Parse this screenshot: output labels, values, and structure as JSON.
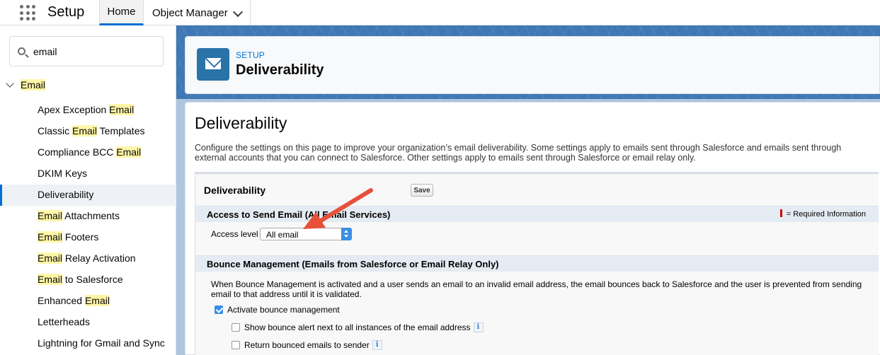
{
  "nav": {
    "app_title": "Setup",
    "tabs": [
      {
        "label": "Home",
        "active": true
      },
      {
        "label": "Object Manager",
        "active": false
      }
    ]
  },
  "sidebar": {
    "search": {
      "value": "email"
    },
    "parent": {
      "label": "Email",
      "expanded": true
    },
    "items": [
      {
        "before": "Apex Exception ",
        "match": "Email",
        "after": ""
      },
      {
        "before": "Classic ",
        "match": "Email",
        "after": " Templates"
      },
      {
        "before": "Compliance BCC ",
        "match": "Email",
        "after": ""
      },
      {
        "before": "DKIM Keys",
        "match": "",
        "after": ""
      },
      {
        "before": "Deliverability",
        "match": "",
        "after": "",
        "selected": true
      },
      {
        "before": "",
        "match": "Email",
        "after": " Attachments"
      },
      {
        "before": "",
        "match": "Email",
        "after": " Footers"
      },
      {
        "before": "",
        "match": "Email",
        "after": " Relay Activation"
      },
      {
        "before": "",
        "match": "Email",
        "after": " to Salesforce"
      },
      {
        "before": "Enhanced ",
        "match": "Email",
        "after": ""
      },
      {
        "before": "Letterheads",
        "match": "",
        "after": ""
      },
      {
        "before": "Lightning for Gmail and Sync",
        "match": "",
        "after": ""
      }
    ]
  },
  "header": {
    "eyebrow": "SETUP",
    "title": "Deliverability",
    "icon": "envelope-icon"
  },
  "main": {
    "page_title": "Deliverability",
    "description": "Configure the settings on this page to improve your organization’s email deliverability. Some settings apply to emails sent through Salesforce and emails sent through external accounts that you can connect to Salesforce. Other settings apply to emails sent through Salesforce or email relay only.",
    "block_title": "Deliverability",
    "save_label": "Save",
    "access_section": {
      "title": "Access to Send Email (All Email Services)",
      "required_note": "= Required Information",
      "access_label": "Access level",
      "access_value": "All email"
    },
    "bounce_section": {
      "title": "Bounce Management (Emails from Salesforce or Email Relay Only)",
      "paragraph": "When Bounce Management is activated and a user sends an email to an invalid email address, the email bounces back to Salesforce and the user is prevented from sending email to that address until it is validated.",
      "checkboxes": [
        {
          "label": "Activate bounce management",
          "checked": true
        },
        {
          "label": "Show bounce alert next to all instances of the email address",
          "checked": false
        },
        {
          "label": "Return bounced emails to sender",
          "checked": false
        }
      ]
    }
  },
  "colors": {
    "accent": "#0070d2",
    "highlight": "#fff7a8",
    "annotation_arrow": "#e8503a",
    "header_icon_bg": "#2a73a9"
  }
}
